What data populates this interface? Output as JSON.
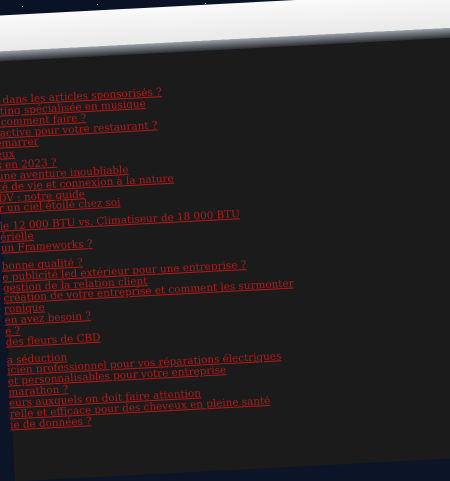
{
  "links": [
    "e dans les articles sponsorisés ?",
    "eting spécialisée en musique",
    ", comment faire ?",
    "ractive pour votre restaurant ?",
    "émarrer",
    "eux",
    "s en 2023 ?",
    "une aventure inoubliable",
    "té de vie et connexion à la nature",
    "DV : notre guide",
    "r un ciel étoilé chez soi",
    "",
    "le 12 000 BTU vs. Climatiseur de 18 000 BTU",
    "érielle",
    "un Frameworks ?",
    "",
    "bonne qualité ?",
    "e publicité led extérieur pour une entreprise ?",
    "gestion de la relation client",
    "création de votre entreprise et comment les surmonter",
    "ronique",
    "en avez besoin ?",
    "e ?",
    " des fleurs de CBD",
    "",
    "a séduction",
    "icien professionnel pour vos réparations électriques",
    "et personnalisables pour votre entreprise",
    " marathon ?",
    "eurs auxquels on doit faire attention",
    "relle et efficace pour des cheveux en pleine santé",
    "ie de données ?"
  ]
}
